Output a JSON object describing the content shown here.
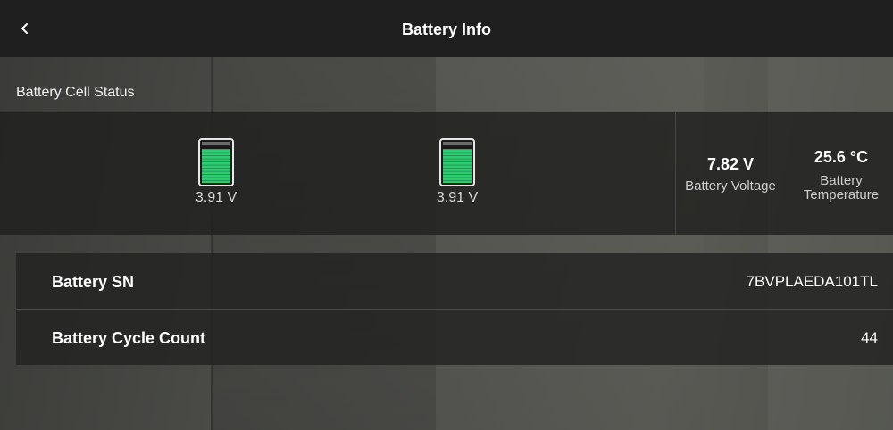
{
  "header": {
    "title": "Battery Info",
    "back_icon": "chevron-left-icon"
  },
  "cell_status": {
    "section_title": "Battery Cell Status",
    "cells": [
      {
        "voltage": "3.91 V",
        "charge_fraction": 0.9,
        "color": "#2ecc71"
      },
      {
        "voltage": "3.91 V",
        "charge_fraction": 0.9,
        "color": "#2ecc71"
      }
    ],
    "voltage": {
      "value": "7.82 V",
      "label": "Battery Voltage"
    },
    "temperature": {
      "value": "25.6 °C",
      "label_line1": "Battery",
      "label_line2": "Temperature"
    }
  },
  "info": {
    "serial": {
      "label": "Battery SN",
      "value": "7BVPLAEDA101TL"
    },
    "cycle_count": {
      "label": "Battery Cycle Count",
      "value": "44"
    }
  },
  "colors": {
    "cell_fill": "#2ecc71",
    "topbar": "#1f1f1f"
  }
}
